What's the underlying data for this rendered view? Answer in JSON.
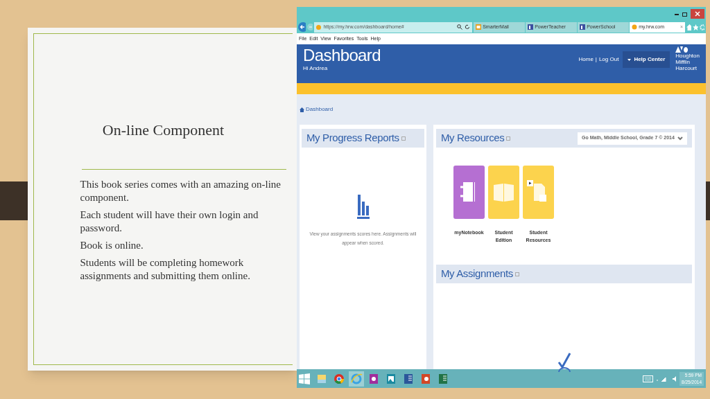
{
  "slide": {
    "title": "On-line Component",
    "paragraphs": [
      "This book series comes with an amazing on-line component.",
      "Each student will have their own login and password.",
      "Book is online.",
      "Students will be completing homework assignments and submitting them online."
    ]
  },
  "browser": {
    "url": "https://my.hrw.com/dashboard/home#",
    "tabs": [
      {
        "label": "SmarterMail",
        "selected": false
      },
      {
        "label": "PowerTeacher",
        "selected": false
      },
      {
        "label": "PowerSchool",
        "selected": false
      },
      {
        "label": "my.hrw.com",
        "selected": true,
        "close": "×"
      }
    ],
    "menu": [
      "File",
      "Edit",
      "View",
      "Favorites",
      "Tools",
      "Help"
    ]
  },
  "page": {
    "title": "Dashboard",
    "greeting": "Hi Andrea",
    "nav_links": [
      "Home",
      "Log Out"
    ],
    "nav_separator": "|",
    "help_center": "Help Center",
    "logo_lines": [
      "Houghton",
      "Mifflin",
      "Harcourt"
    ],
    "breadcrumb": "Dashboard",
    "progress": {
      "title": "My Progress Reports",
      "message": "View your assignments scores here. Assignments will appear when scored."
    },
    "resources": {
      "title": "My Resources",
      "program": "Go Math, Middle School, Grade 7 © 2014",
      "tiles": [
        {
          "kind": "notebook",
          "label": "myNotebook",
          "color": "#b56fd2"
        },
        {
          "kind": "book",
          "label": "Student Edition",
          "color": "#fcd34d"
        },
        {
          "kind": "files",
          "label": "Student Resources",
          "color": "#fcd34d"
        }
      ]
    },
    "assignments": {
      "title": "My Assignments"
    }
  },
  "taskbar": {
    "time": "5:59 PM",
    "date": "8/25/2014",
    "apps": [
      {
        "kind": "folder",
        "selected": false
      },
      {
        "kind": "chrome",
        "selected": false
      },
      {
        "kind": "ie",
        "selected": true
      },
      {
        "kind": "camera",
        "selected": false
      },
      {
        "kind": "photos",
        "selected": false
      },
      {
        "kind": "word",
        "selected": false
      },
      {
        "kind": "powerpoint",
        "selected": false
      },
      {
        "kind": "excel",
        "selected": false
      }
    ]
  }
}
